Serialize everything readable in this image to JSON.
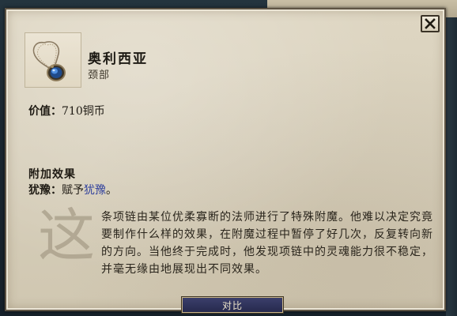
{
  "item": {
    "name": "奥利西亚",
    "type": "颈部",
    "icon": "amulet-icon"
  },
  "value": {
    "label": "价值：",
    "amount": "710铜币"
  },
  "effects": {
    "header": "附加效果",
    "name": "犹豫：",
    "prefix": "赋予",
    "link": "犹豫",
    "suffix": "。"
  },
  "description": {
    "drop_cap": "这",
    "text": "条项链由某位优柔寡断的法师进行了特殊附魔。他难以决定究竟要制作什么样的效果，在附魔过程中暂停了好几次，反复转向新的方向。当他终于完成时，他发现项链中的灵魂能力很不稳定，并毫无缘由地展现出不同效果。"
  },
  "buttons": {
    "compare": "对比",
    "close_icon": "close-icon"
  },
  "colors": {
    "parchment": "#d7cfbb",
    "link": "#2f3f9c",
    "button": "#2b2e55"
  }
}
